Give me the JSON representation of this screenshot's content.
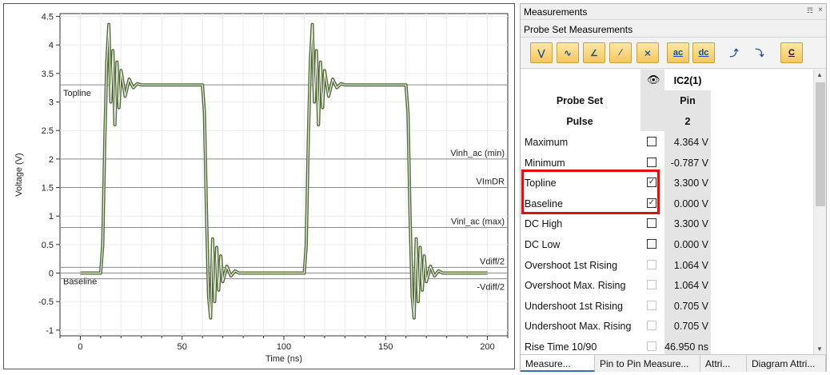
{
  "chart_data": {
    "type": "line",
    "xlabel": "Time (ns)",
    "ylabel": "Voltage (V)",
    "xlim": [
      -10,
      210
    ],
    "ylim": [
      -1.1,
      4.55
    ],
    "xticks": [
      "0",
      "50",
      "100",
      "150",
      "200"
    ],
    "xtick_values": [
      0,
      50,
      100,
      150,
      200
    ],
    "yticks": [
      "4.5",
      "4",
      "3.5",
      "3",
      "2.5",
      "2",
      "1.5",
      "1",
      "0.5",
      "0",
      "-0.5",
      "-1"
    ],
    "ytick_values": [
      4.5,
      4,
      3.5,
      3,
      2.5,
      2,
      1.5,
      1,
      0.5,
      0,
      -0.5,
      -1
    ],
    "grid": true,
    "reference_lines": [
      {
        "label": "Topline",
        "y": 3.3,
        "label_side": "left"
      },
      {
        "label": "Vinh_ac (min)",
        "y": 2.0,
        "label_side": "right"
      },
      {
        "label": "VImDR",
        "y": 1.5,
        "label_side": "right"
      },
      {
        "label": "Vinl_ac (max)",
        "y": 0.8,
        "label_side": "right"
      },
      {
        "label": "Vdiff/2",
        "y": 0.1,
        "label_side": "right"
      },
      {
        "label": "Baseline",
        "y": 0.0,
        "label_side": "left"
      },
      {
        "label": "-Vdiff/2",
        "y": -0.1,
        "label_side": "right"
      }
    ],
    "series": [
      {
        "color": "#556b3a",
        "x": [
          0,
          10,
          11,
          12,
          13,
          14,
          15,
          16,
          17,
          18,
          19,
          20,
          22,
          24,
          26,
          28,
          30,
          40,
          50,
          60,
          61,
          62,
          63,
          64,
          65,
          66,
          67,
          68,
          69,
          70,
          72,
          74,
          76,
          78,
          80,
          90,
          100,
          110,
          111,
          112,
          113,
          114,
          115,
          116,
          117,
          118,
          119,
          120,
          122,
          124,
          126,
          128,
          130,
          140,
          150,
          160,
          161,
          162,
          163,
          164,
          165,
          166,
          167,
          168,
          169,
          170,
          172,
          174,
          176,
          178,
          180,
          190,
          200
        ],
        "y": [
          0,
          0,
          0.5,
          2.3,
          3.7,
          4.36,
          3.0,
          3.9,
          2.6,
          3.7,
          2.9,
          3.55,
          3.1,
          3.4,
          3.25,
          3.32,
          3.3,
          3.3,
          3.3,
          3.3,
          2.8,
          1.0,
          -0.4,
          -0.787,
          0.6,
          -0.5,
          0.45,
          -0.3,
          0.3,
          -0.15,
          0.12,
          -0.05,
          0.04,
          0.0,
          0.0,
          0.0,
          0.0,
          0.0,
          0.5,
          2.3,
          3.7,
          4.36,
          3.0,
          3.9,
          2.6,
          3.7,
          2.9,
          3.55,
          3.1,
          3.4,
          3.25,
          3.32,
          3.3,
          3.3,
          3.3,
          3.3,
          2.8,
          1.0,
          -0.4,
          -0.787,
          0.6,
          -0.5,
          0.45,
          -0.3,
          0.3,
          -0.15,
          0.12,
          -0.05,
          0.04,
          0.0,
          0.0,
          0.0,
          0.0
        ]
      }
    ]
  },
  "measurements": {
    "title": "Measurements",
    "subtitle": "Probe Set Measurements",
    "column_header": "IC2(1)",
    "row_probe_set_label": "Probe Set",
    "row_probe_set_value": "Pin",
    "row_pulse_label": "Pulse",
    "row_pulse_value": "2",
    "rows": [
      {
        "label": "Maximum",
        "checked": false,
        "enabled": true,
        "value": "4.364 V"
      },
      {
        "label": "Minimum",
        "checked": false,
        "enabled": true,
        "value": "-0.787 V"
      },
      {
        "label": "Topline",
        "checked": true,
        "enabled": true,
        "value": "3.300 V"
      },
      {
        "label": "Baseline",
        "checked": true,
        "enabled": true,
        "value": "0.000 V"
      },
      {
        "label": "DC High",
        "checked": false,
        "enabled": true,
        "value": "3.300 V"
      },
      {
        "label": "DC Low",
        "checked": false,
        "enabled": true,
        "value": "0.000 V"
      },
      {
        "label": "Overshoot 1st Rising",
        "checked": false,
        "enabled": false,
        "value": "1.064 V"
      },
      {
        "label": "Overshoot Max. Rising",
        "checked": false,
        "enabled": false,
        "value": "1.064 V"
      },
      {
        "label": "Undershoot 1st Rising",
        "checked": false,
        "enabled": false,
        "value": "0.705 V"
      },
      {
        "label": "Undershoot Max. Rising",
        "checked": false,
        "enabled": false,
        "value": "0.705 V"
      },
      {
        "label": "Rise Time 10/90",
        "checked": false,
        "enabled": false,
        "value": "46.950 ns"
      }
    ],
    "toolbar": [
      {
        "icon": "vpp-icon",
        "text": ""
      },
      {
        "icon": "waveform-icon",
        "text": ""
      },
      {
        "icon": "slew-icon",
        "text": ""
      },
      {
        "icon": "slope-icon",
        "text": ""
      },
      {
        "icon": "crossing-icon",
        "text": ""
      },
      {
        "icon": "ac-icon",
        "text": "ac"
      },
      {
        "icon": "dc-icon",
        "text": "dc"
      },
      {
        "icon": "rising-edge-icon",
        "text": ""
      },
      {
        "icon": "falling-edge-icon",
        "text": ""
      },
      {
        "icon": "c-icon",
        "text": "C"
      }
    ],
    "tabs": [
      "Measure...",
      "Pin to Pin Measure...",
      "Attri...",
      "Diagram Attri..."
    ],
    "active_tab": 0
  }
}
